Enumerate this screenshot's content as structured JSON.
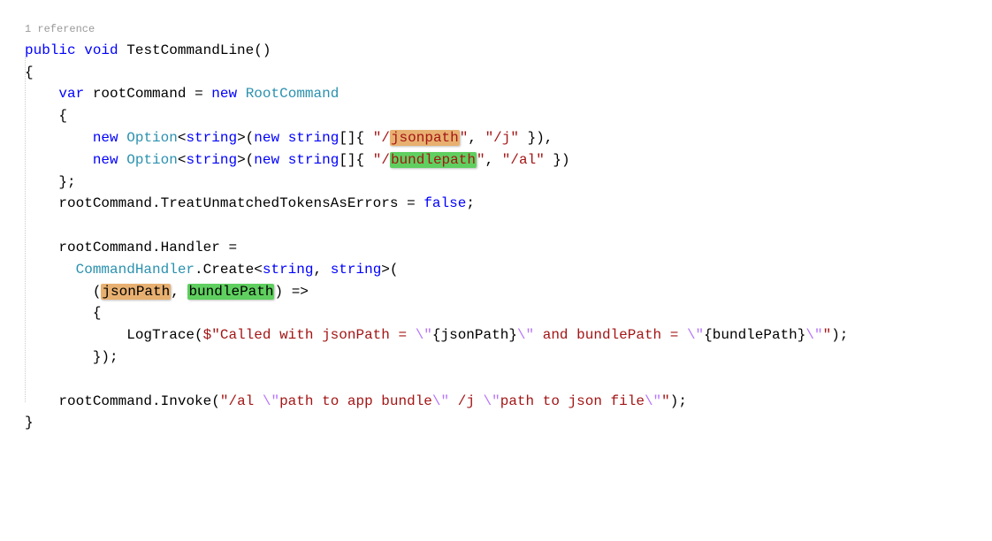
{
  "codelens": "1 reference",
  "code": {
    "kw_public": "public",
    "kw_void": "void",
    "method_name": "TestCommandLine",
    "paren_empty": "()",
    "brace_open": "{",
    "brace_close": "}",
    "kw_var": "var",
    "var_root": "rootCommand",
    "equals": "=",
    "kw_new": "new",
    "type_RootCommand": "RootCommand",
    "type_Option": "Option",
    "type_string": "string",
    "arr_open": "[]{",
    "str_jsonpath": "\"/",
    "hl_jsonpath": "jsonpath",
    "str_close_q": "\"",
    "comma": ",",
    "str_j": "\"/j\"",
    "arr_close": "})",
    "str_bundlepath_open": "\"/",
    "hl_bundlepath": "bundlepath",
    "str_al": "\"/al\"",
    "brace_close_semi": "};",
    "prop_treat": "TreatUnmatchedTokensAsErrors",
    "kw_false": "false",
    "semi": ";",
    "prop_handler": "Handler",
    "type_CommandHandler": "CommandHandler",
    "method_Create": "Create",
    "lt": "<",
    "gt": ">",
    "paren_open": "(",
    "hl_jsonPath": "jsonPath",
    "hl_bundlePath": "bundlePath",
    "paren_close": ")",
    "arrow": "=>",
    "method_LogTrace": "LogTrace",
    "dollar": "$",
    "str_tpl1": "\"Called with jsonPath = ",
    "esc_q": "\\\"",
    "interp_open": "{",
    "interp_jsonPath": "jsonPath",
    "interp_close": "}",
    "str_tpl2": " and bundlePath = ",
    "interp_bundlePath": "bundlePath",
    "str_tpl_end": "\"",
    "paren_close_semi": ");",
    "brace_close_paren_semi": "});",
    "method_Invoke": "Invoke",
    "str_invoke1": "\"/al ",
    "str_invoke_lit1": "path to app bundle",
    "str_invoke_mid": " /j ",
    "str_invoke_lit2": "path to json file",
    "str_invoke_end": "\""
  }
}
